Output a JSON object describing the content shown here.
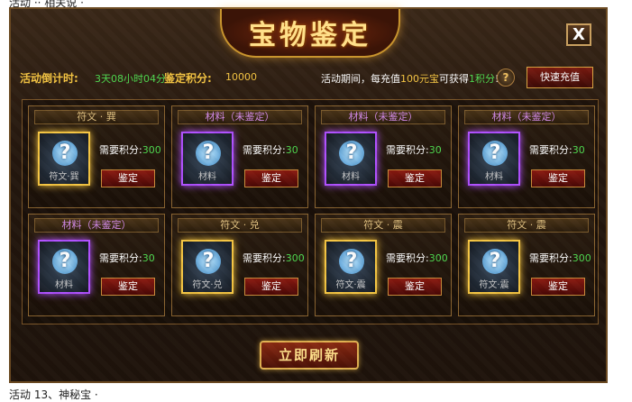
{
  "page_top_text": "活动 ·· 相关说 ·",
  "page_bottom_text": "活动 13、神秘宝 ·",
  "title": "宝物鉴定",
  "close_label": "X",
  "info": {
    "countdown_label": "活动倒计时:",
    "countdown_value": "3天08小时04分",
    "points_label": "鉴定积分:",
    "points_value": "10000",
    "promo_prefix": "活动期间，每充值",
    "promo_amount": "100元宝",
    "promo_middle": "可获得",
    "promo_points": "1积分",
    "promo_suffix": "!",
    "help_label": "?",
    "recharge_label": "快速充值"
  },
  "need_label": "需要积分:",
  "appraise_label": "鉴定",
  "refresh_label": "立即刷新",
  "cards": [
    {
      "title": "符文 · 巽",
      "type": "rune",
      "slot_label": "符文·巽",
      "cost": "300"
    },
    {
      "title": "材料（未鉴定）",
      "type": "mat",
      "slot_label": "材料",
      "cost": "30"
    },
    {
      "title": "材料（未鉴定）",
      "type": "mat",
      "slot_label": "材料",
      "cost": "30"
    },
    {
      "title": "材料（未鉴定）",
      "type": "mat",
      "slot_label": "材料",
      "cost": "30"
    },
    {
      "title": "材料（未鉴定）",
      "type": "mat",
      "slot_label": "材料",
      "cost": "30"
    },
    {
      "title": "符文 · 兑",
      "type": "rune",
      "slot_label": "符文·兑",
      "cost": "300"
    },
    {
      "title": "符文 · 震",
      "type": "rune",
      "slot_label": "符文·震",
      "cost": "300"
    },
    {
      "title": "符文 · 震",
      "type": "rune",
      "slot_label": "符文·震",
      "cost": "300"
    }
  ],
  "colors": {
    "rune_glow": "#f5c542",
    "material_glow": "#b050ff",
    "points_green": "#4fd84f"
  },
  "icons": {
    "question": "question-mark-icon",
    "help": "help-icon",
    "close": "close-icon"
  }
}
